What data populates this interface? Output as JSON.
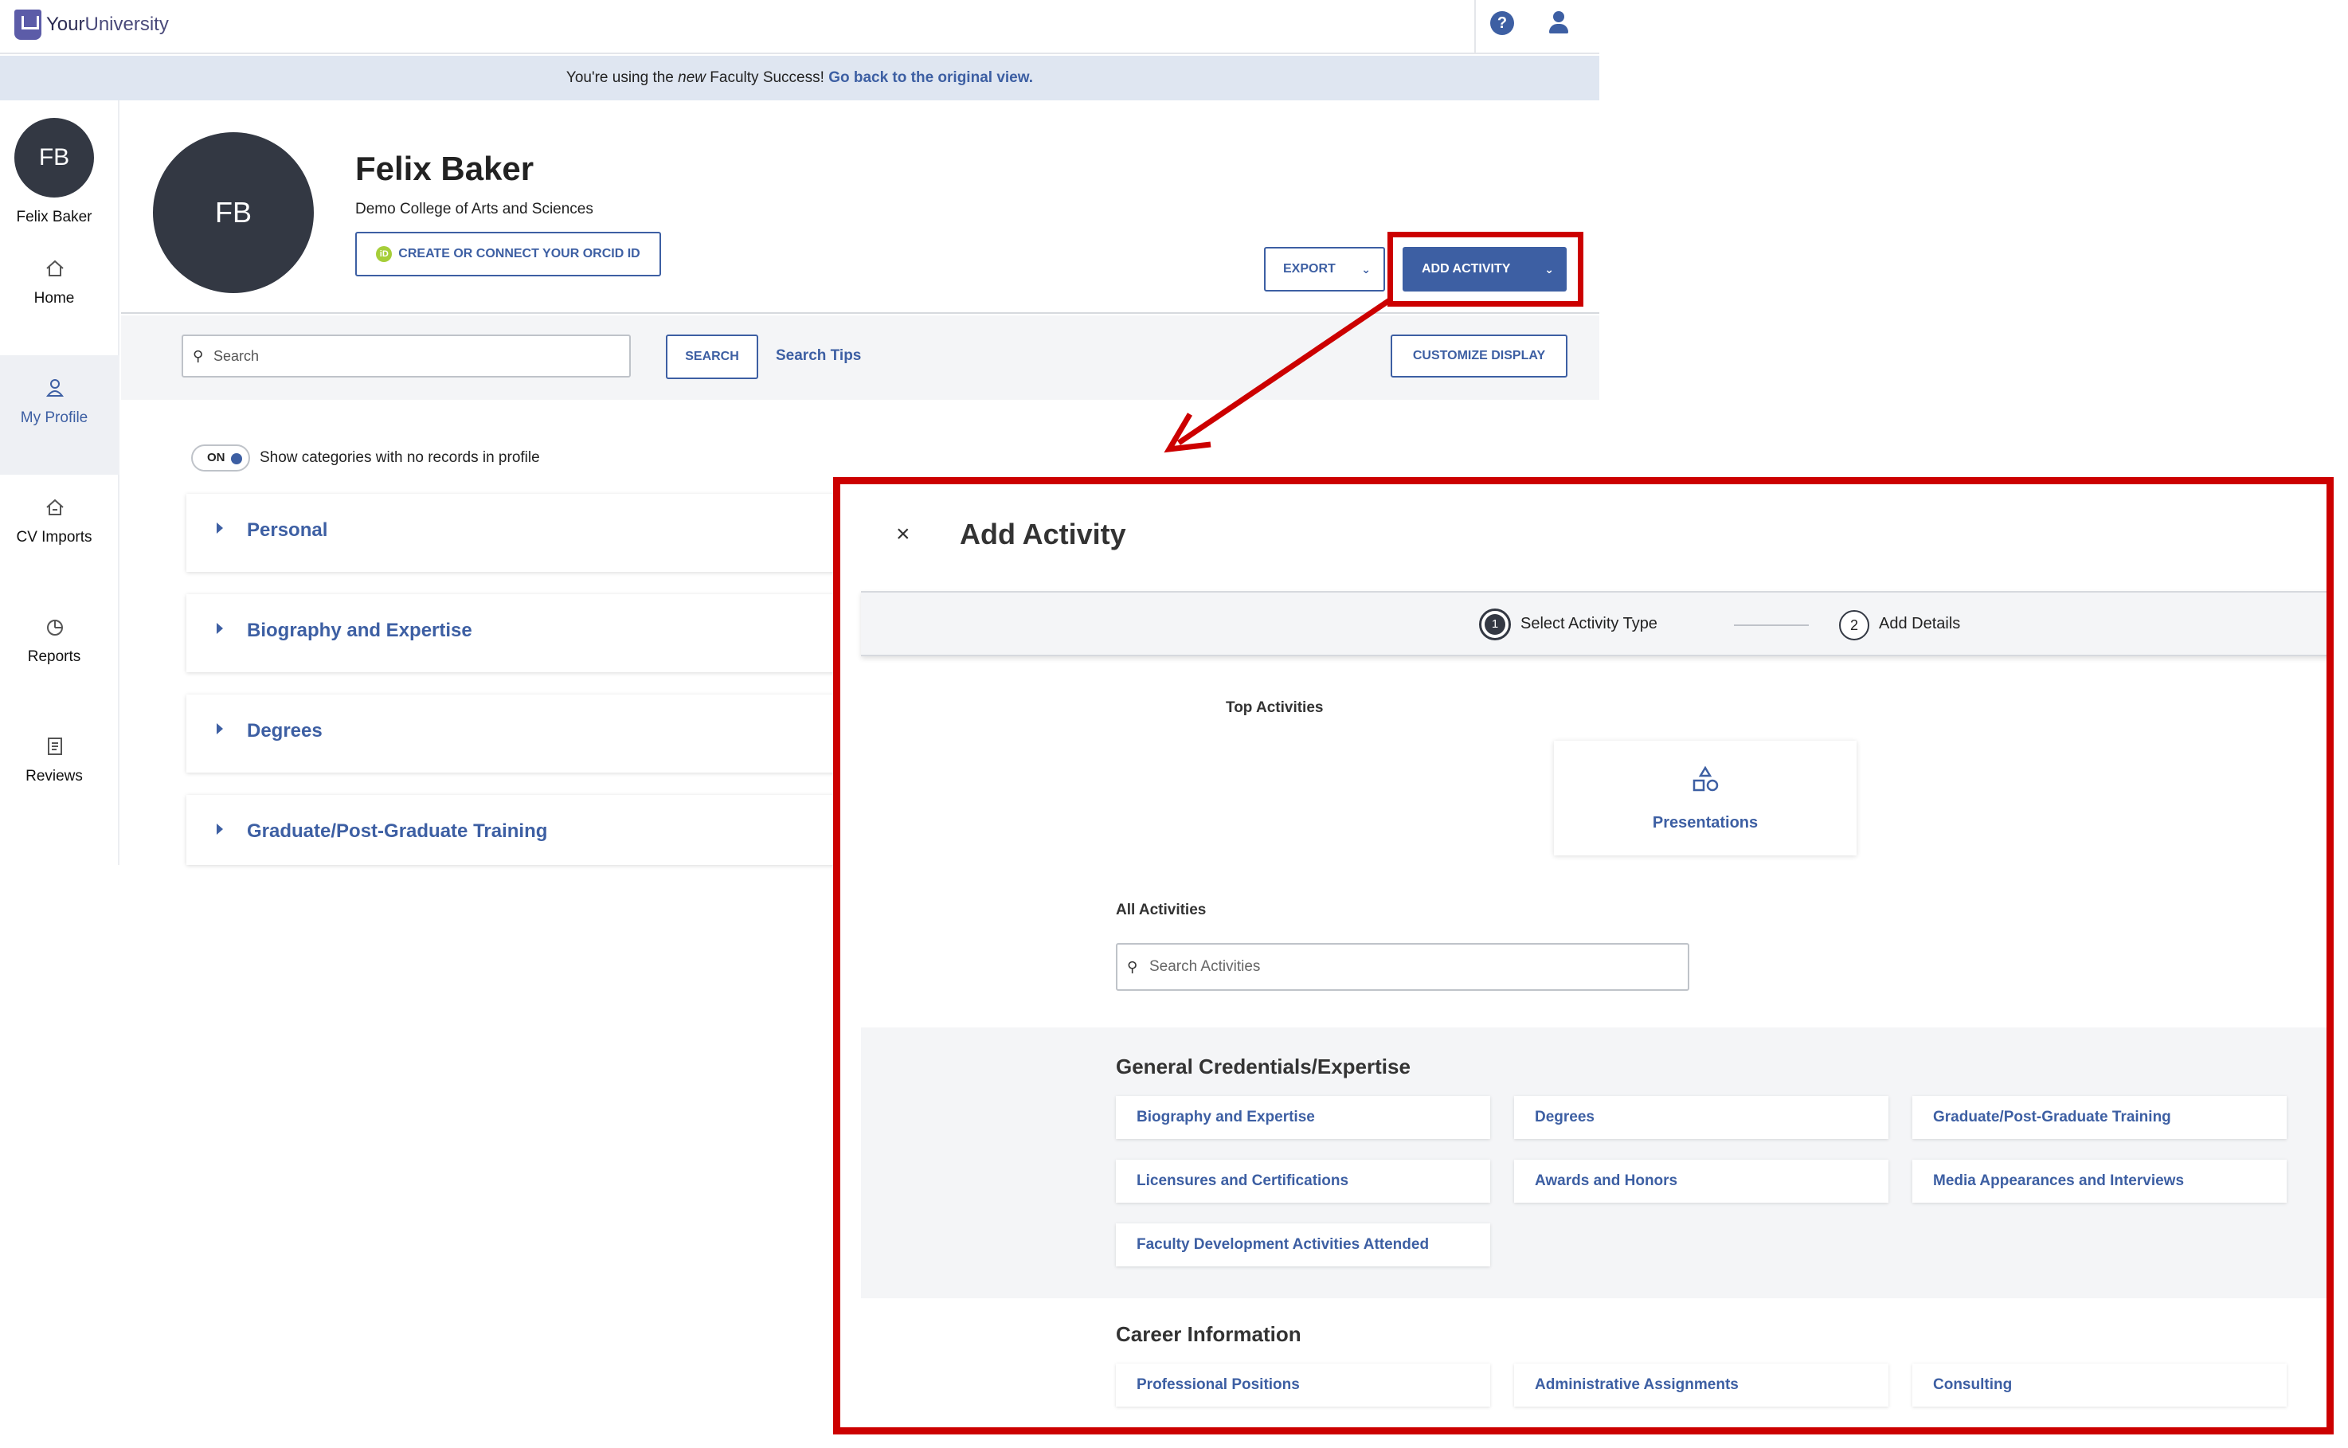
{
  "header": {
    "logo_text_a": "Your",
    "logo_text_b": "University",
    "help_icon": "question-circle-icon",
    "user_icon": "user-icon"
  },
  "banner": {
    "text_before": "You're using the ",
    "text_em": "new",
    "text_after": " Faculty Success! ",
    "link": "Go back to the original view."
  },
  "sidebar": {
    "avatar_initials": "FB",
    "user_name": "Felix Baker",
    "items": [
      {
        "label": "Home",
        "icon": "home-icon"
      },
      {
        "label": "My Profile",
        "icon": "person-icon"
      },
      {
        "label": "CV Imports",
        "icon": "import-icon"
      },
      {
        "label": "Reports",
        "icon": "pie-chart-icon"
      },
      {
        "label": "Reviews",
        "icon": "document-icon"
      }
    ]
  },
  "profile": {
    "initials": "FB",
    "name": "Felix Baker",
    "college": "Demo College of Arts and Sciences",
    "orcid_button": "CREATE OR CONNECT YOUR ORCID ID",
    "orcid_badge": "iD",
    "export_button": "EXPORT",
    "add_activity_button": "ADD ACTIVITY"
  },
  "search": {
    "placeholder": "Search",
    "button": "SEARCH",
    "tips": "Search Tips",
    "customize_button": "CUSTOMIZE DISPLAY"
  },
  "toggle": {
    "state": "ON",
    "label": "Show categories with no records in profile"
  },
  "categories": [
    "Personal",
    "Biography and Expertise",
    "Degrees",
    "Graduate/Post-Graduate Training"
  ],
  "modal": {
    "close": "×",
    "title": "Add Activity",
    "steps": [
      {
        "number": "1",
        "label": "Select Activity Type"
      },
      {
        "number": "2",
        "label": "Add Details"
      }
    ],
    "top_activities_label": "Top Activities",
    "top_activities": [
      {
        "label": "Presentations",
        "icon": "shapes-icon"
      }
    ],
    "all_activities_label": "All Activities",
    "search_placeholder": "Search Activities",
    "sections": [
      {
        "title": "General Credentials/Expertise",
        "items": [
          "Biography and Expertise",
          "Degrees",
          "Graduate/Post-Graduate Training",
          "Licensures and Certifications",
          "Awards and Honors",
          "Media Appearances and Interviews",
          "Faculty Development Activities Attended"
        ]
      },
      {
        "title": "Career Information",
        "items": [
          "Professional Positions",
          "Administrative Assignments",
          "Consulting"
        ]
      }
    ]
  },
  "colors": {
    "accent": "#3d5fa3",
    "annotation": "#cc0000",
    "avatar": "#333843"
  }
}
